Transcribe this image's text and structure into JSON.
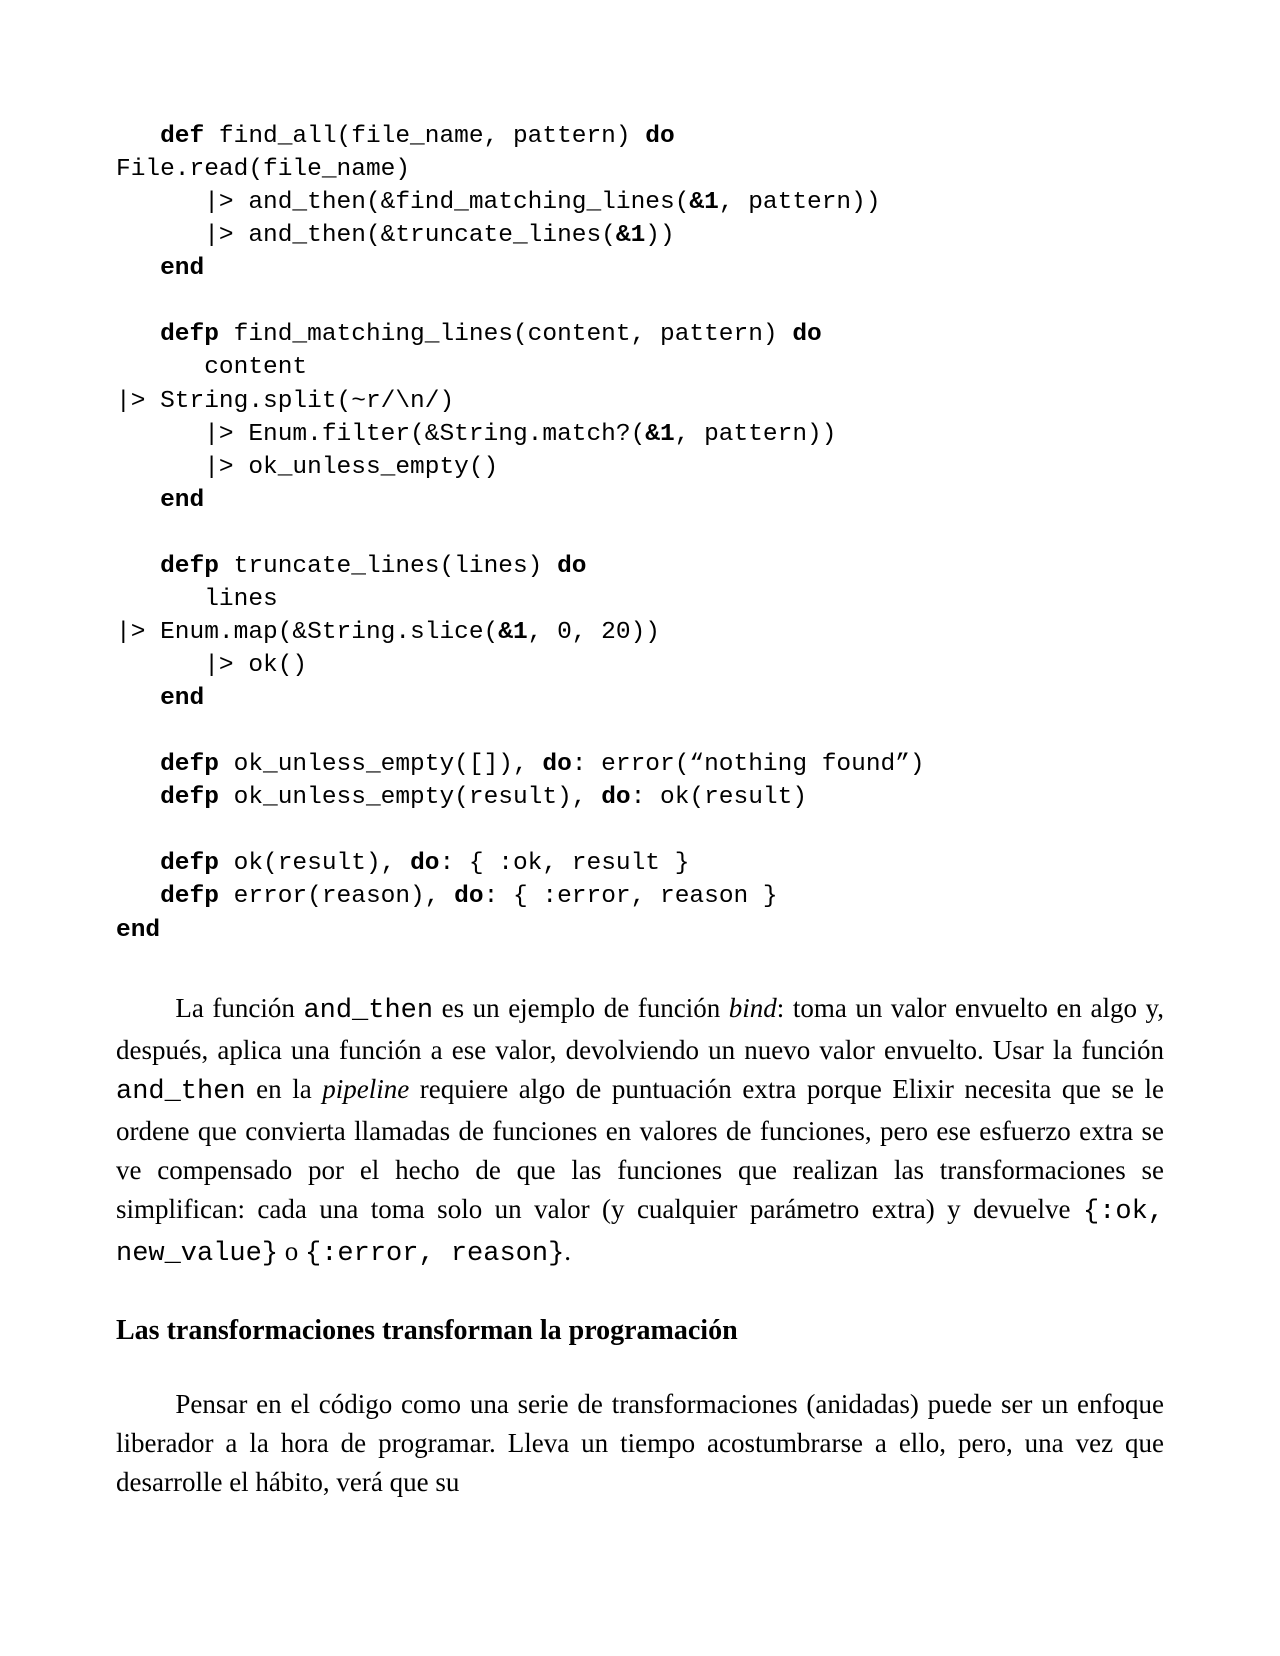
{
  "code": {
    "l01_a": "   ",
    "l01_kw1": "def",
    "l01_b": " find_all(file_name, pattern) ",
    "l01_kw2": "do",
    "l02": "File.read(file_name)",
    "l03_a": "      |> and_then(&find_matching_lines(",
    "l03_kw": "&1",
    "l03_b": ", pattern))",
    "l04_a": "      |> and_then(&truncate_lines(",
    "l04_kw": "&1",
    "l04_b": "))",
    "l05_a": "   ",
    "l05_kw": "end",
    "blank1": "",
    "l06_a": "   ",
    "l06_kw1": "defp",
    "l06_b": " find_matching_lines(content, pattern) ",
    "l06_kw2": "do",
    "l07": "      content",
    "l08": "|> String.split(~r/\\n/)",
    "l09_a": "      |> Enum.filter(&String.match?(",
    "l09_kw": "&1",
    "l09_b": ", pattern))",
    "l10": "      |> ok_unless_empty()",
    "l11_a": "   ",
    "l11_kw": "end",
    "blank2": "",
    "l12_a": "   ",
    "l12_kw1": "defp",
    "l12_b": " truncate_lines(lines) ",
    "l12_kw2": "do",
    "l13": "      lines",
    "l14_a": "|> Enum.map(&String.slice(",
    "l14_kw": "&1",
    "l14_b": ", 0, 20))",
    "l15": "      |> ok()",
    "l16_a": "   ",
    "l16_kw": "end",
    "blank3": "",
    "l17_a": "   ",
    "l17_kw1": "defp",
    "l17_b": " ok_unless_empty([]), ",
    "l17_kw2": "do",
    "l17_c": ": error(“nothing found”)",
    "l18_a": "   ",
    "l18_kw1": "defp",
    "l18_b": " ok_unless_empty(result), ",
    "l18_kw2": "do",
    "l18_c": ": ok(result)",
    "blank4": "",
    "l19_a": "   ",
    "l19_kw1": "defp",
    "l19_b": " ok(result), ",
    "l19_kw2": "do",
    "l19_c": ": { :ok, result }",
    "l20_a": "   ",
    "l20_kw1": "defp",
    "l20_b": " error(reason), ",
    "l20_kw2": "do",
    "l20_c": ": { :error, reason }",
    "l21_kw": "end"
  },
  "para1": {
    "t1": "La función ",
    "m1": "and_then",
    "t2": " es un ejemplo de función ",
    "i1": "bind",
    "t3": ": toma un valor envuelto en algo y, después, aplica una función a ese valor, devolviendo un nuevo valor envuelto. Usar la función ",
    "m2": "and_then",
    "t4": " en la ",
    "i2": "pipeline",
    "t5": " requiere algo de puntuación extra porque Elixir necesita que se le ordene que convierta llamadas de funciones en valores de funciones, pero ese esfuerzo extra se ve compensado por el hecho de que las funciones que realizan las transformaciones se simplifican: cada una toma solo un valor (y cualquier parámetro extra) y devuelve ",
    "m3": "{:ok, new_value}",
    "t6": " o ",
    "m4": "{:error, reason}",
    "t7": "."
  },
  "heading": "Las transformaciones transforman la programación",
  "para2": {
    "t1": "Pensar en el código como una serie de transformaciones (anidadas) puede ser un enfoque liberador a la hora de programar. Lleva un tiempo acostumbrarse a ello, pero, una vez que desarrolle el hábito, verá que su"
  }
}
